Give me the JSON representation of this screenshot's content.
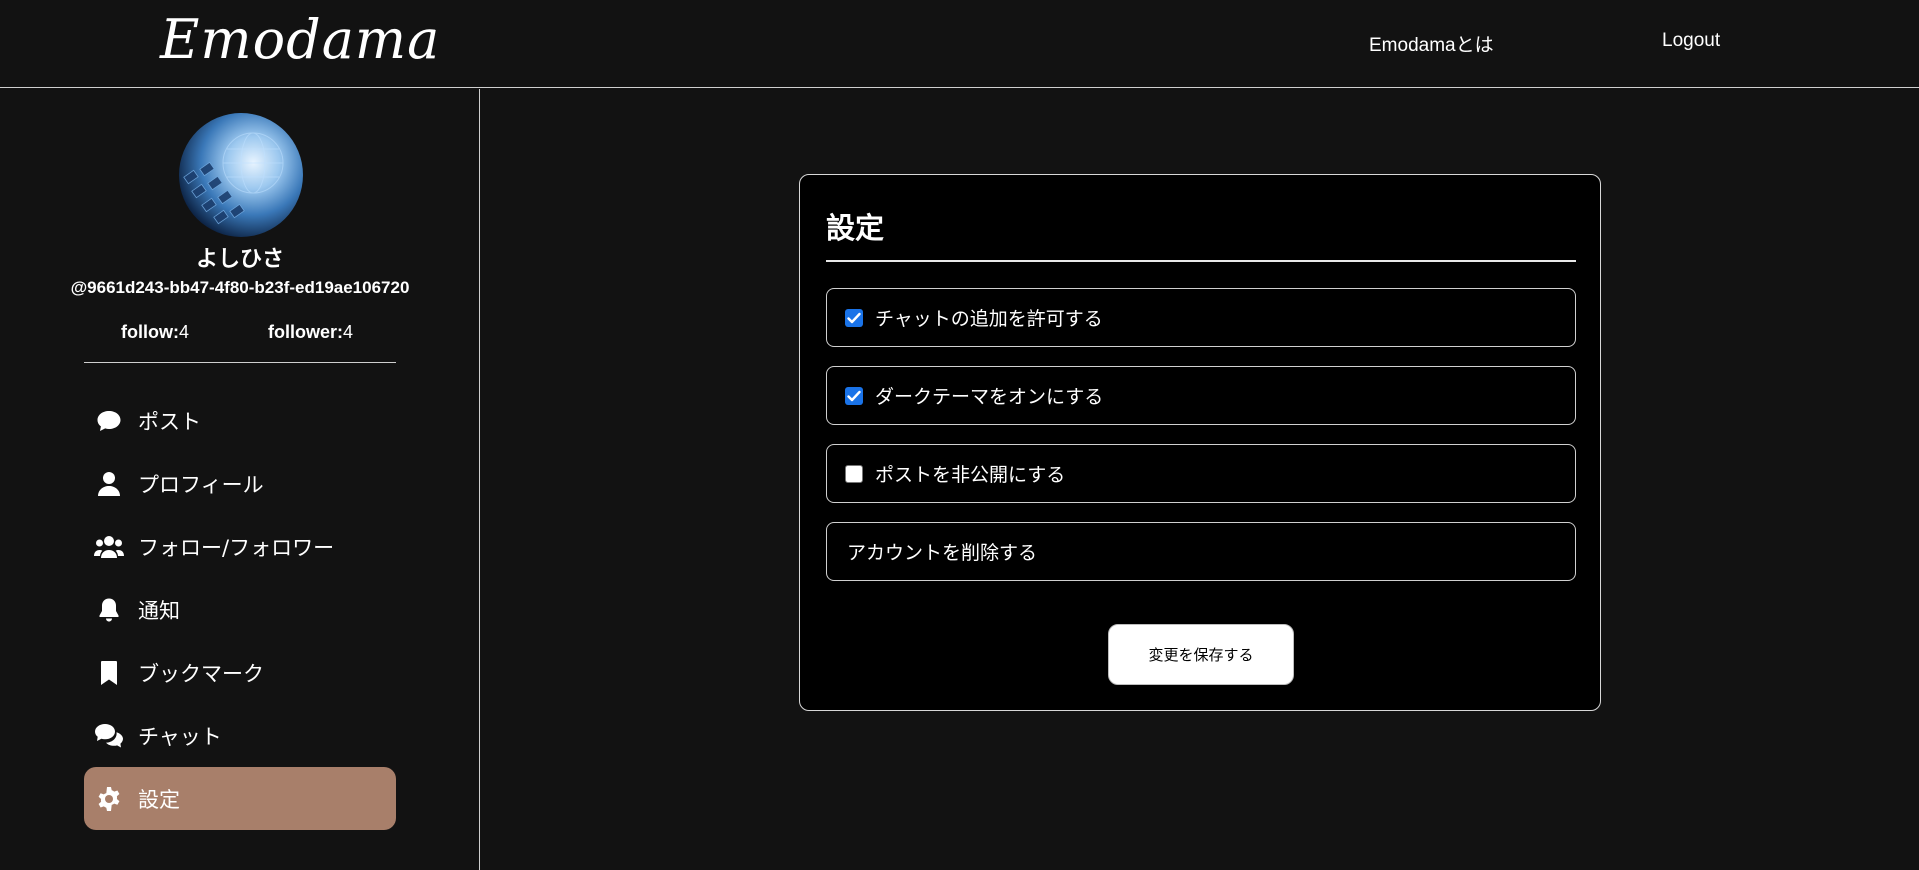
{
  "header": {
    "logo": "Emodama",
    "nav": {
      "about": "Emodamaとは",
      "logout": "Logout"
    }
  },
  "profile": {
    "name": "よしひさ",
    "handle": "@9661d243-bb47-4f80-b23f-ed19ae106720",
    "follow_label": "follow:",
    "follow_count": "4",
    "follower_label": "follower:",
    "follower_count": "4"
  },
  "sidebar": {
    "items": [
      {
        "label": "ポスト",
        "icon": "speech-bubble-icon",
        "active": false
      },
      {
        "label": "プロフィール",
        "icon": "user-icon",
        "active": false
      },
      {
        "label": "フォロー/フォロワー",
        "icon": "users-icon",
        "active": false
      },
      {
        "label": "通知",
        "icon": "bell-icon",
        "active": false
      },
      {
        "label": "ブックマーク",
        "icon": "bookmark-icon",
        "active": false
      },
      {
        "label": "チャット",
        "icon": "chat-bubbles-icon",
        "active": false
      },
      {
        "label": "設定",
        "icon": "gear-icon",
        "active": true
      }
    ]
  },
  "settings": {
    "title": "設定",
    "options": [
      {
        "label": "チャットの追加を許可する",
        "checked": true
      },
      {
        "label": "ダークテーマをオンにする",
        "checked": true
      },
      {
        "label": "ポストを非公開にする",
        "checked": false
      }
    ],
    "delete_account": "アカウントを削除する",
    "save_button": "変更を保存する"
  },
  "colors": {
    "background": "#121212",
    "card": "#000000",
    "active_menu": "#a87f6a",
    "checkbox_checked": "#1a73e8"
  }
}
